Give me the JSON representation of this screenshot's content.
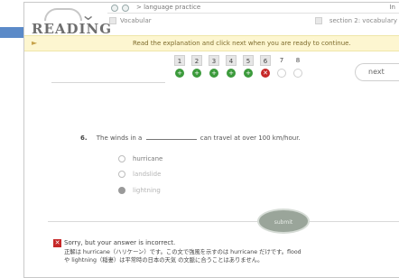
{
  "header": {
    "logo_text": "READING",
    "breadcrumb": "language practice",
    "tab_end": "In",
    "vocab_label": "Vocabular",
    "section_label": "section 2: vocabulary"
  },
  "instruction": {
    "text": "Read the explanation and click next when you are ready to continue."
  },
  "progress": {
    "numbers": [
      "1",
      "2",
      "3",
      "4",
      "5",
      "6",
      "7",
      "8"
    ],
    "results": [
      "correct",
      "correct",
      "correct",
      "correct",
      "correct",
      "incorrect",
      "empty",
      "empty"
    ],
    "next_label": "next"
  },
  "question": {
    "number": "6.",
    "text_before": "The winds in a",
    "text_after": "can travel at over 100 km/hour.",
    "options": [
      "hurricane",
      "landslide",
      "lightning"
    ]
  },
  "submit_label": "submit",
  "feedback": {
    "line1": "Sorry, but your answer is incorrect.",
    "line2": "正解は hurricane（ハリケーン）です。この文で強風を示すのは hurricane だけです。flood",
    "line3": "や lightning（稲妻）は平常時の日本の天気 の文脈に合うことはありません。"
  },
  "colors": {
    "accent_blue": "#5b8ac8",
    "correct_green": "#3b9a3b",
    "incorrect_red": "#c62828",
    "notice_yellow": "#fdf6d0"
  }
}
